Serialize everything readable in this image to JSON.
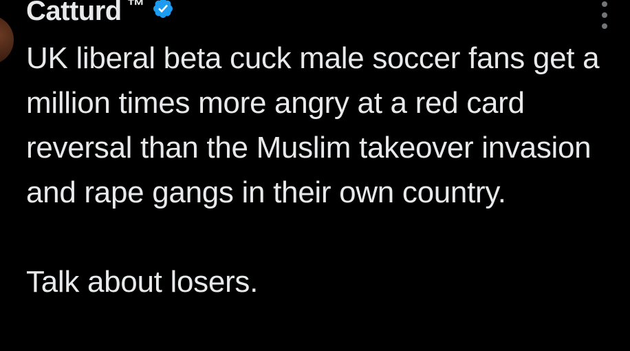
{
  "tweet": {
    "author": {
      "name": "Catturd",
      "suffix": "™",
      "verified_icon": "verified-badge-icon",
      "verified_color": "#1d9bf0"
    },
    "more_icon": "more-options-icon",
    "text_paragraph_1": "UK liberal beta cuck male soccer fans get a million times more angry at a red card reversal than the Muslim takeover invasion and rape gangs in their own country.",
    "text_paragraph_2": "Talk about losers."
  },
  "colors": {
    "background": "#000000",
    "text": "#e7e9ea",
    "muted": "#71767b"
  }
}
